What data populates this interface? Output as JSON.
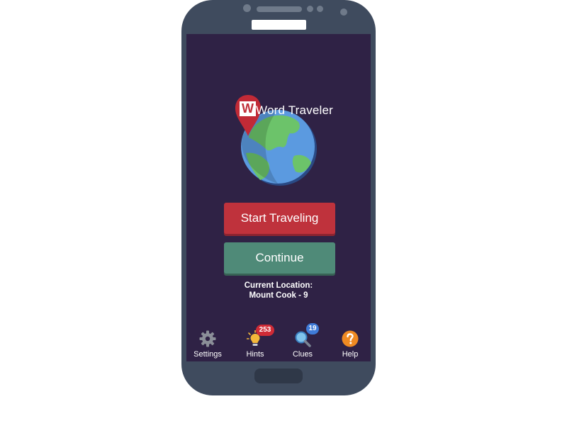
{
  "app": {
    "title": "Word Traveler",
    "logo_letter": "W"
  },
  "buttons": {
    "start_label": "Start Traveling",
    "continue_label": "Continue"
  },
  "location": {
    "caption": "Current Location:",
    "value": "Mount Cook - 9"
  },
  "nav": {
    "settings": {
      "label": "Settings",
      "icon": "gear-icon"
    },
    "hints": {
      "label": "Hints",
      "icon": "lightbulb-icon",
      "count": "253"
    },
    "clues": {
      "label": "Clues",
      "icon": "magnifier-icon",
      "count": "19"
    },
    "help": {
      "label": "Help",
      "icon": "question-icon"
    }
  },
  "colors": {
    "screen_bg": "#2f2245",
    "start_button": "#bf323c",
    "continue_button": "#4f8a78",
    "phone_body": "#3f4b5e"
  }
}
